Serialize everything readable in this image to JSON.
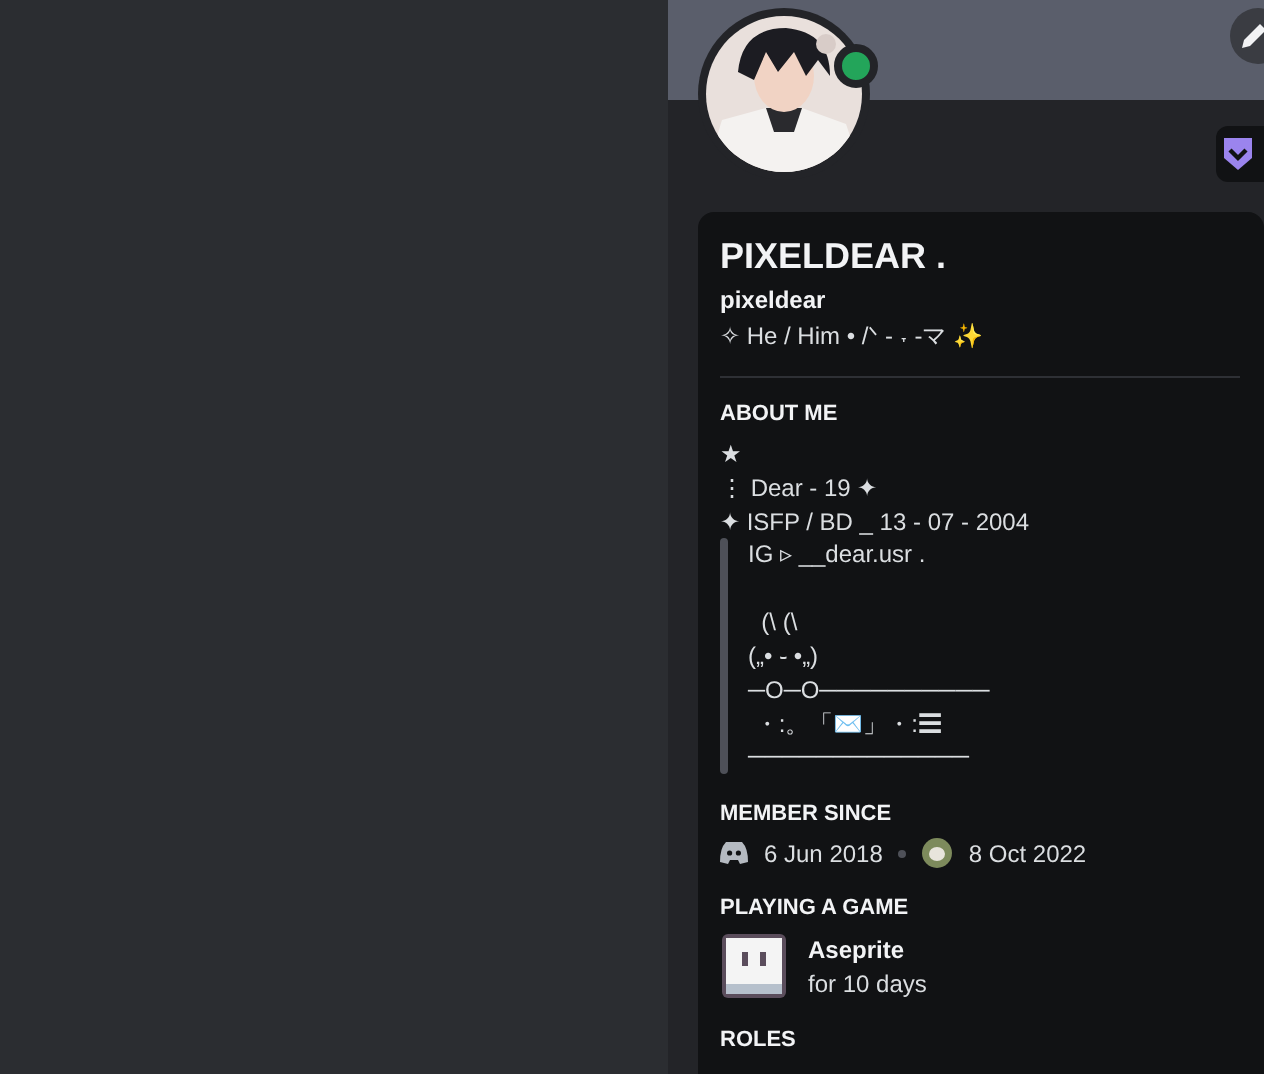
{
  "profile": {
    "online": true,
    "display_name": "PIXELDEAR .",
    "username": "pixeldear",
    "pronouns": "✧ He / Him • /ᐠ - ˕ -マ ✨"
  },
  "about_me": {
    "heading": "ABOUT ME",
    "lines": [
      "★",
      "⋮ Dear - 19 ✦",
      "✦ ISFP / BD _ 13 - 07 - 2004"
    ],
    "quote": [
      {
        "lines": [
          "IG ▹ __dear.usr ."
        ]
      },
      {
        "lines": [
          "  (\\ (\\",
          "(„• ֊ •„)",
          "─O─O──────────",
          " ・:。「✉️」・:☰",
          "─────────────"
        ]
      }
    ]
  },
  "member_since": {
    "heading": "MEMBER SINCE",
    "discord_date": "6 Jun 2018",
    "server_date": "8 Oct 2022"
  },
  "activity": {
    "heading": "PLAYING A GAME",
    "game": "Aseprite",
    "duration": "for 10 days"
  },
  "roles": {
    "heading": "ROLES"
  }
}
